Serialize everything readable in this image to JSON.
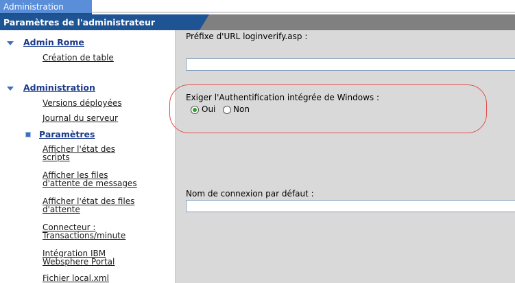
{
  "tab": {
    "label": "Administration"
  },
  "header": {
    "title": "Paramètres de l'administrateur"
  },
  "sidebar": {
    "group1": {
      "label": "Admin Rome",
      "items": [
        "Création de table"
      ]
    },
    "group2": {
      "label": "Administration",
      "items": [
        "Versions déployées",
        "Journal du serveur",
        "Paramètres",
        "Afficher l'état des scripts",
        "Afficher les files d'attente de messages",
        "Afficher l'état des files d'attente",
        "Connecteur : Transactions/minute",
        "Intégration IBM Websphere Portal",
        "Fichier local.xml"
      ]
    },
    "lines": {
      "scripts_1": "Afficher l'état des",
      "scripts_2": "scripts",
      "files_1": "Afficher les files",
      "files_2": "d'attente de messages",
      "etatfiles_1": "Afficher l'état des files",
      "etatfiles_2": "d'attente",
      "conn_1": "Connecteur :",
      "conn_2": "Transactions/minute",
      "ibm_1": "Intégration IBM",
      "ibm_2": "Websphere Portal"
    }
  },
  "main": {
    "url_prefix": {
      "label": "Préfixe d'URL loginverify.asp :",
      "value": ""
    },
    "windows_auth": {
      "label": "Exiger l'Authentification intégrée de Windows :",
      "yes": "Oui",
      "no": "Non",
      "selected": "Oui"
    },
    "default_login": {
      "label": "Nom de connexion par défaut :",
      "value": ""
    }
  },
  "colors": {
    "tab": "#5a8ed8",
    "header": "#1e5493",
    "highlight": "#e24c4c"
  }
}
